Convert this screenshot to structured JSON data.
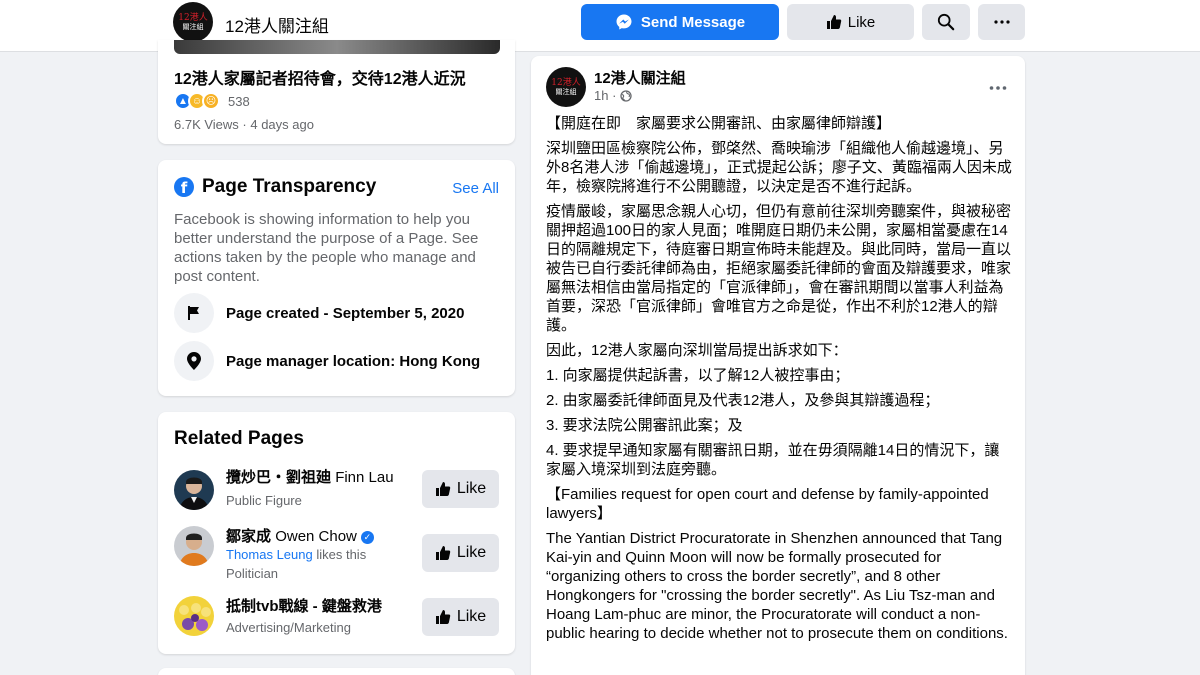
{
  "topbar": {
    "page_name": "12港人關注組",
    "send_message_label": "Send Message",
    "like_label": "Like",
    "avatar_line1": "12港人",
    "avatar_line2": "關注組"
  },
  "video": {
    "title": "12港人家屬記者招待會，交待12港人近況",
    "reaction_count": "538",
    "meta": "6.7K Views · 4 days ago"
  },
  "transparency": {
    "title": "Page Transparency",
    "see_all": "See All",
    "description": "Facebook is showing information to help you better understand the purpose of a Page. See actions taken by the people who manage and post content.",
    "page_created": "Page created - September 5, 2020",
    "manager_location": "Page manager location: Hong Kong"
  },
  "related": {
    "title": "Related Pages",
    "like_label": "Like",
    "items": [
      {
        "name_zh": "攬炒巴・劉祖廸",
        "name_en": "Finn Lau",
        "category": "Public Figure"
      },
      {
        "name_zh": "鄒家成",
        "name_en": "Owen Chow",
        "friend": "Thomas Leung",
        "friend_suffix": " likes this",
        "category": "Politician"
      },
      {
        "name_zh": "抵制tvb戰線 - 鍵盤救港",
        "name_en": "",
        "category": "Advertising/Marketing"
      }
    ]
  },
  "post": {
    "author": "12港人關注組",
    "time": "1h ·",
    "paragraphs": [
      "【開庭在即　家屬要求公開審訊、由家屬律師辯護】",
      "深圳鹽田區檢察院公佈，鄧棨然、喬映瑜涉「組織他人偷越邊境」、另外8名港人涉「偷越邊境」，正式提起公訴；廖子文、黃臨福兩人因未成年，檢察院將進行不公開聽證，以決定是否不進行起訴。",
      "疫情嚴峻，家屬思念親人心切，但仍有意前往深圳旁聽案件，與被秘密關押超過100日的家人見面；唯開庭日期仍未公開，家屬相當憂慮在14日的隔離規定下，待庭審日期宣佈時未能趕及。與此同時，當局一直以被告已自行委託律師為由，拒絕家屬委託律師的會面及辯護要求，唯家屬無法相信由當局指定的「官派律師」，會在審訊期間以當事人利益為首要，深恐「官派律師」會唯官方之命是從，作出不利於12港人的辯護。",
      "因此，12港人家屬向深圳當局提出訴求如下：",
      "1. 向家屬提供起訴書，以了解12人被控事由；",
      "2. 由家屬委託律師面見及代表12港人，及參與其辯護過程；",
      "3. 要求法院公開審訊此案；及",
      "4. 要求提早通知家屬有關審訊日期，並在毋須隔離14日的情況下，讓家屬入境深圳到法庭旁聽。",
      "【Families request for open court and defense by family-appointed lawyers】",
      "The Yantian District Procuratorate in Shenzhen announced that Tang Kai-yin and Quinn Moon will now be formally prosecuted for “organizing others to cross the border secretly”, and 8 other Hongkongers for \"crossing the border  secretly\". As Liu Tsz-man and Hoang Lam-phuc are minor, the Procuratorate will conduct a non-public hearing to decide whether not to prosecute them on conditions."
    ]
  },
  "colors": {
    "accent": "#1877f2",
    "background": "#f0f2f5",
    "secondary_text": "#65676b"
  }
}
